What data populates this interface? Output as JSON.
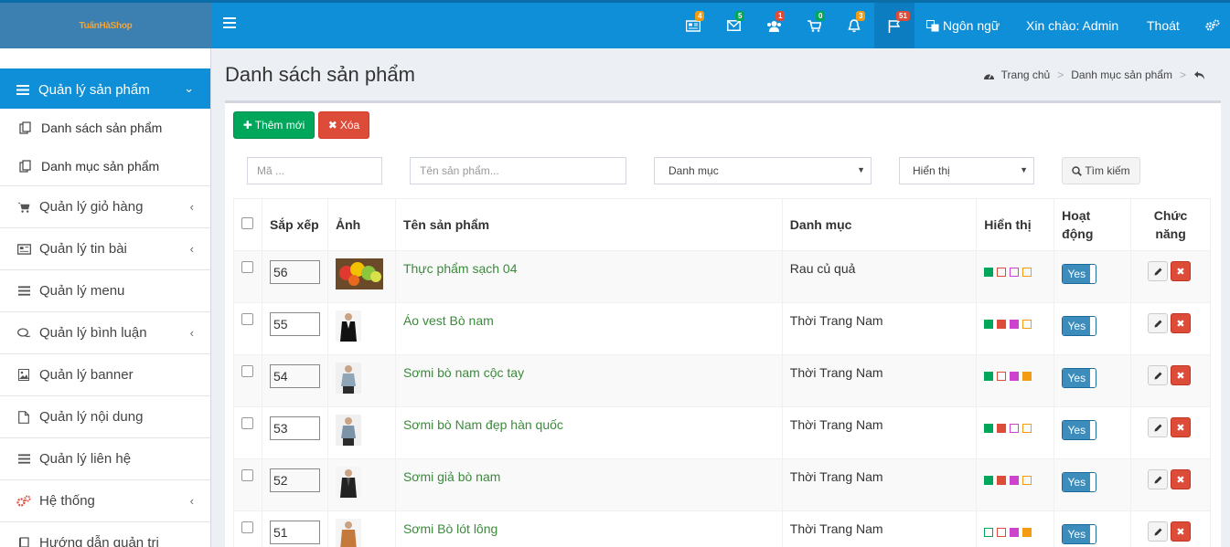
{
  "logo": {
    "text": "TuấnHàShop"
  },
  "topbar": {
    "badges": [
      "4",
      "5",
      "1",
      "0",
      "3",
      "51"
    ],
    "language": "Ngôn ngữ",
    "greeting": "Xin chào: Admin",
    "logout": "Thoát"
  },
  "sidebar": {
    "active": "Quản lý sản phẩm",
    "sub": [
      "Danh sách sản phẩm",
      "Danh mục sản phẩm"
    ],
    "items": [
      "Quản lý giỏ hàng",
      "Quản lý tin bài",
      "Quản lý menu",
      "Quản lý bình luận",
      "Quản lý banner",
      "Quản lý nội dung",
      "Quản lý liên hệ",
      "Hệ thống",
      "Hướng dẫn quản trị"
    ]
  },
  "page": {
    "title": "Danh sách sản phẩm"
  },
  "breadcrumb": {
    "home": "Trang chủ",
    "current": "Danh mục sản phẩm"
  },
  "toolbar": {
    "add_label": "Thêm mới",
    "delete_label": "Xóa"
  },
  "filters": {
    "code_placeholder": "Mã ...",
    "name_placeholder": "Tên sản phẩm...",
    "category_selected": "Danh mục",
    "display_selected": "Hiển thị",
    "search_label": "Tìm kiếm"
  },
  "table": {
    "headers": {
      "order": "Sắp xếp",
      "image": "Ảnh",
      "name": "Tên sản phẩm",
      "category": "Danh mục",
      "display": "Hiển thị",
      "active_line1": "Hoạt",
      "active_line2": "động",
      "actions_line1": "Chức",
      "actions_line2": "năng"
    },
    "rows": [
      {
        "order": "56",
        "name": "Thực phẩm sạch 04",
        "category": "Rau củ quả",
        "active": "Yes",
        "flags": [
          true,
          false,
          false,
          false
        ]
      },
      {
        "order": "55",
        "name": "Áo vest Bò nam",
        "category": "Thời Trang Nam",
        "active": "Yes",
        "flags": [
          true,
          true,
          true,
          false
        ]
      },
      {
        "order": "54",
        "name": "Sơmi bò nam cộc tay",
        "category": "Thời Trang Nam",
        "active": "Yes",
        "flags": [
          true,
          false,
          true,
          true
        ]
      },
      {
        "order": "53",
        "name": "Sơmi bò Nam đẹp hàn quốc",
        "category": "Thời Trang Nam",
        "active": "Yes",
        "flags": [
          true,
          true,
          false,
          false
        ]
      },
      {
        "order": "52",
        "name": "Sơmi giả bò nam",
        "category": "Thời Trang Nam",
        "active": "Yes",
        "flags": [
          true,
          true,
          true,
          false
        ]
      },
      {
        "order": "51",
        "name": "Sơmi Bò lót lông",
        "category": "Thời Trang Nam",
        "active": "Yes",
        "flags": [
          false,
          false,
          true,
          true
        ]
      }
    ]
  },
  "colors": {
    "primary": "#0e8fd8",
    "success": "#00a65a",
    "danger": "#dd4b39",
    "flag_colors": [
      "#00a65a",
      "#dd4b39",
      "#cc44cc",
      "#f39c12"
    ]
  }
}
